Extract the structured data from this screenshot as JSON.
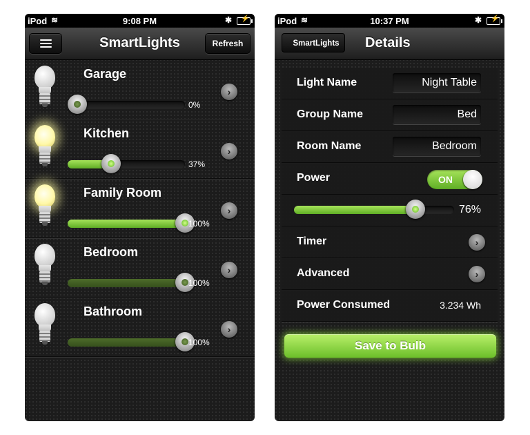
{
  "left_screen": {
    "status": {
      "carrier": "iPod",
      "time": "9:08 PM"
    },
    "nav": {
      "title": "SmartLights",
      "refresh_label": "Refresh"
    },
    "lights": [
      {
        "name": "Garage",
        "percent_label": "0%",
        "level": 0,
        "on": false
      },
      {
        "name": "Kitchen",
        "percent_label": "37%",
        "level": 0.37,
        "on": true
      },
      {
        "name": "Family Room",
        "percent_label": "100%",
        "level": 1.0,
        "on": true
      },
      {
        "name": "Bedroom",
        "percent_label": "100%",
        "level": 1.0,
        "on": false
      },
      {
        "name": "Bathroom",
        "percent_label": "100%",
        "level": 1.0,
        "on": false
      }
    ]
  },
  "right_screen": {
    "status": {
      "carrier": "iPod",
      "time": "10:37 PM"
    },
    "nav": {
      "back_label": "SmartLights",
      "title": "Details"
    },
    "fields": {
      "light_name_label": "Light Name",
      "light_name_value": "Night Table",
      "group_name_label": "Group Name",
      "group_name_value": "Bed",
      "room_name_label": "Room Name",
      "room_name_value": "Bedroom"
    },
    "power": {
      "label": "Power",
      "toggle_label": "ON"
    },
    "brightness": {
      "level": 0.76,
      "percent_label": "76%"
    },
    "timer_label": "Timer",
    "advanced_label": "Advanced",
    "power_consumed": {
      "label": "Power Consumed",
      "value": "3.234 Wh"
    },
    "save_label": "Save to Bulb"
  },
  "colors": {
    "accent_green": "#7cc83a",
    "background": "#1c1c1c"
  }
}
